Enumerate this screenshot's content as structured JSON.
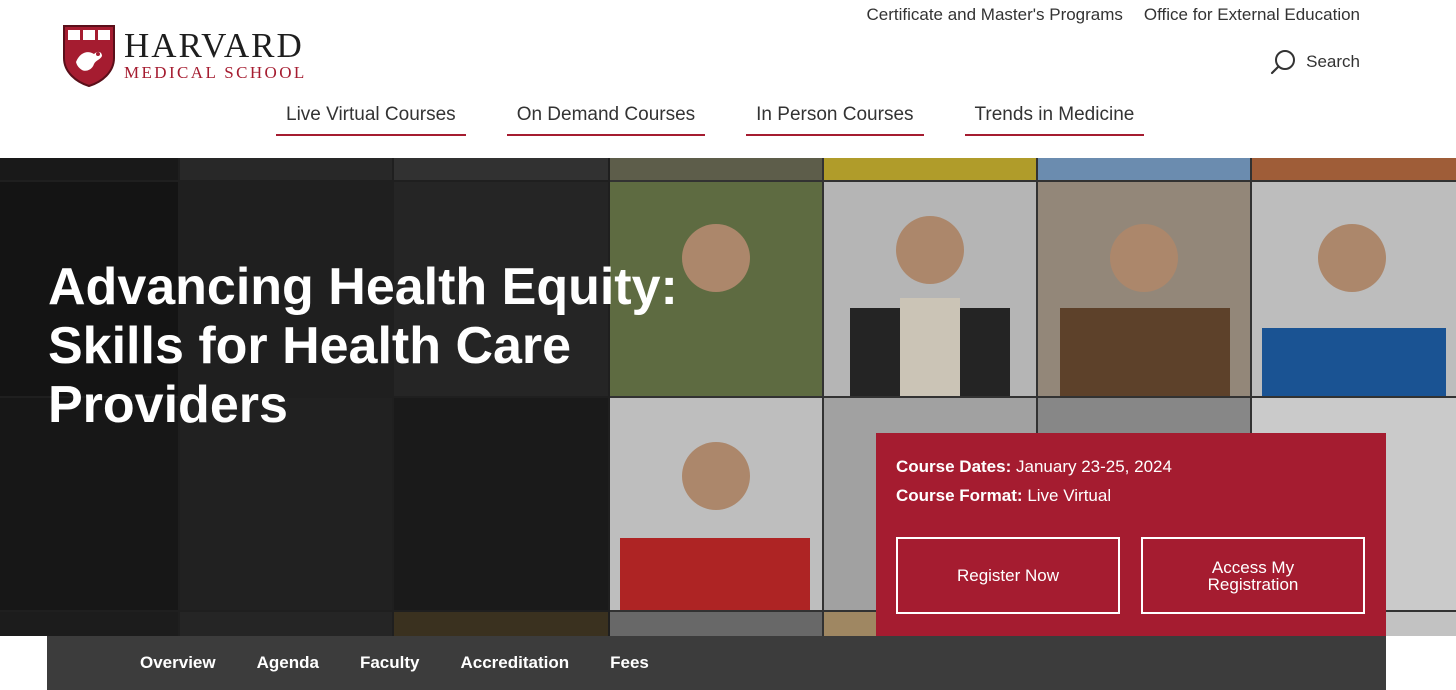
{
  "logo": {
    "name": "HARVARD",
    "school": "MEDICAL SCHOOL"
  },
  "top_links": [
    "Certificate and Master's Programs",
    "Office for External Education"
  ],
  "search": {
    "label": "Search"
  },
  "main_nav": [
    "Live Virtual Courses",
    "On Demand Courses",
    "In Person Courses",
    "Trends in Medicine"
  ],
  "hero": {
    "title": "Advancing Health Equity: Skills for Health Care Providers"
  },
  "course": {
    "dates_label": "Course Dates:",
    "dates_value": "January 23-25, 2024",
    "format_label": "Course Format:",
    "format_value": "Live Virtual",
    "register_label": "Register Now",
    "access_label": "Access My Registration"
  },
  "sub_nav": [
    "Overview",
    "Agenda",
    "Faculty",
    "Accreditation",
    "Fees"
  ],
  "colors": {
    "brand": "#a51c30",
    "subnav_bg": "#3c3c3c",
    "text": "#333333"
  },
  "icons": {
    "logo_shield": "harvard-shield-icon",
    "search": "search-icon"
  }
}
